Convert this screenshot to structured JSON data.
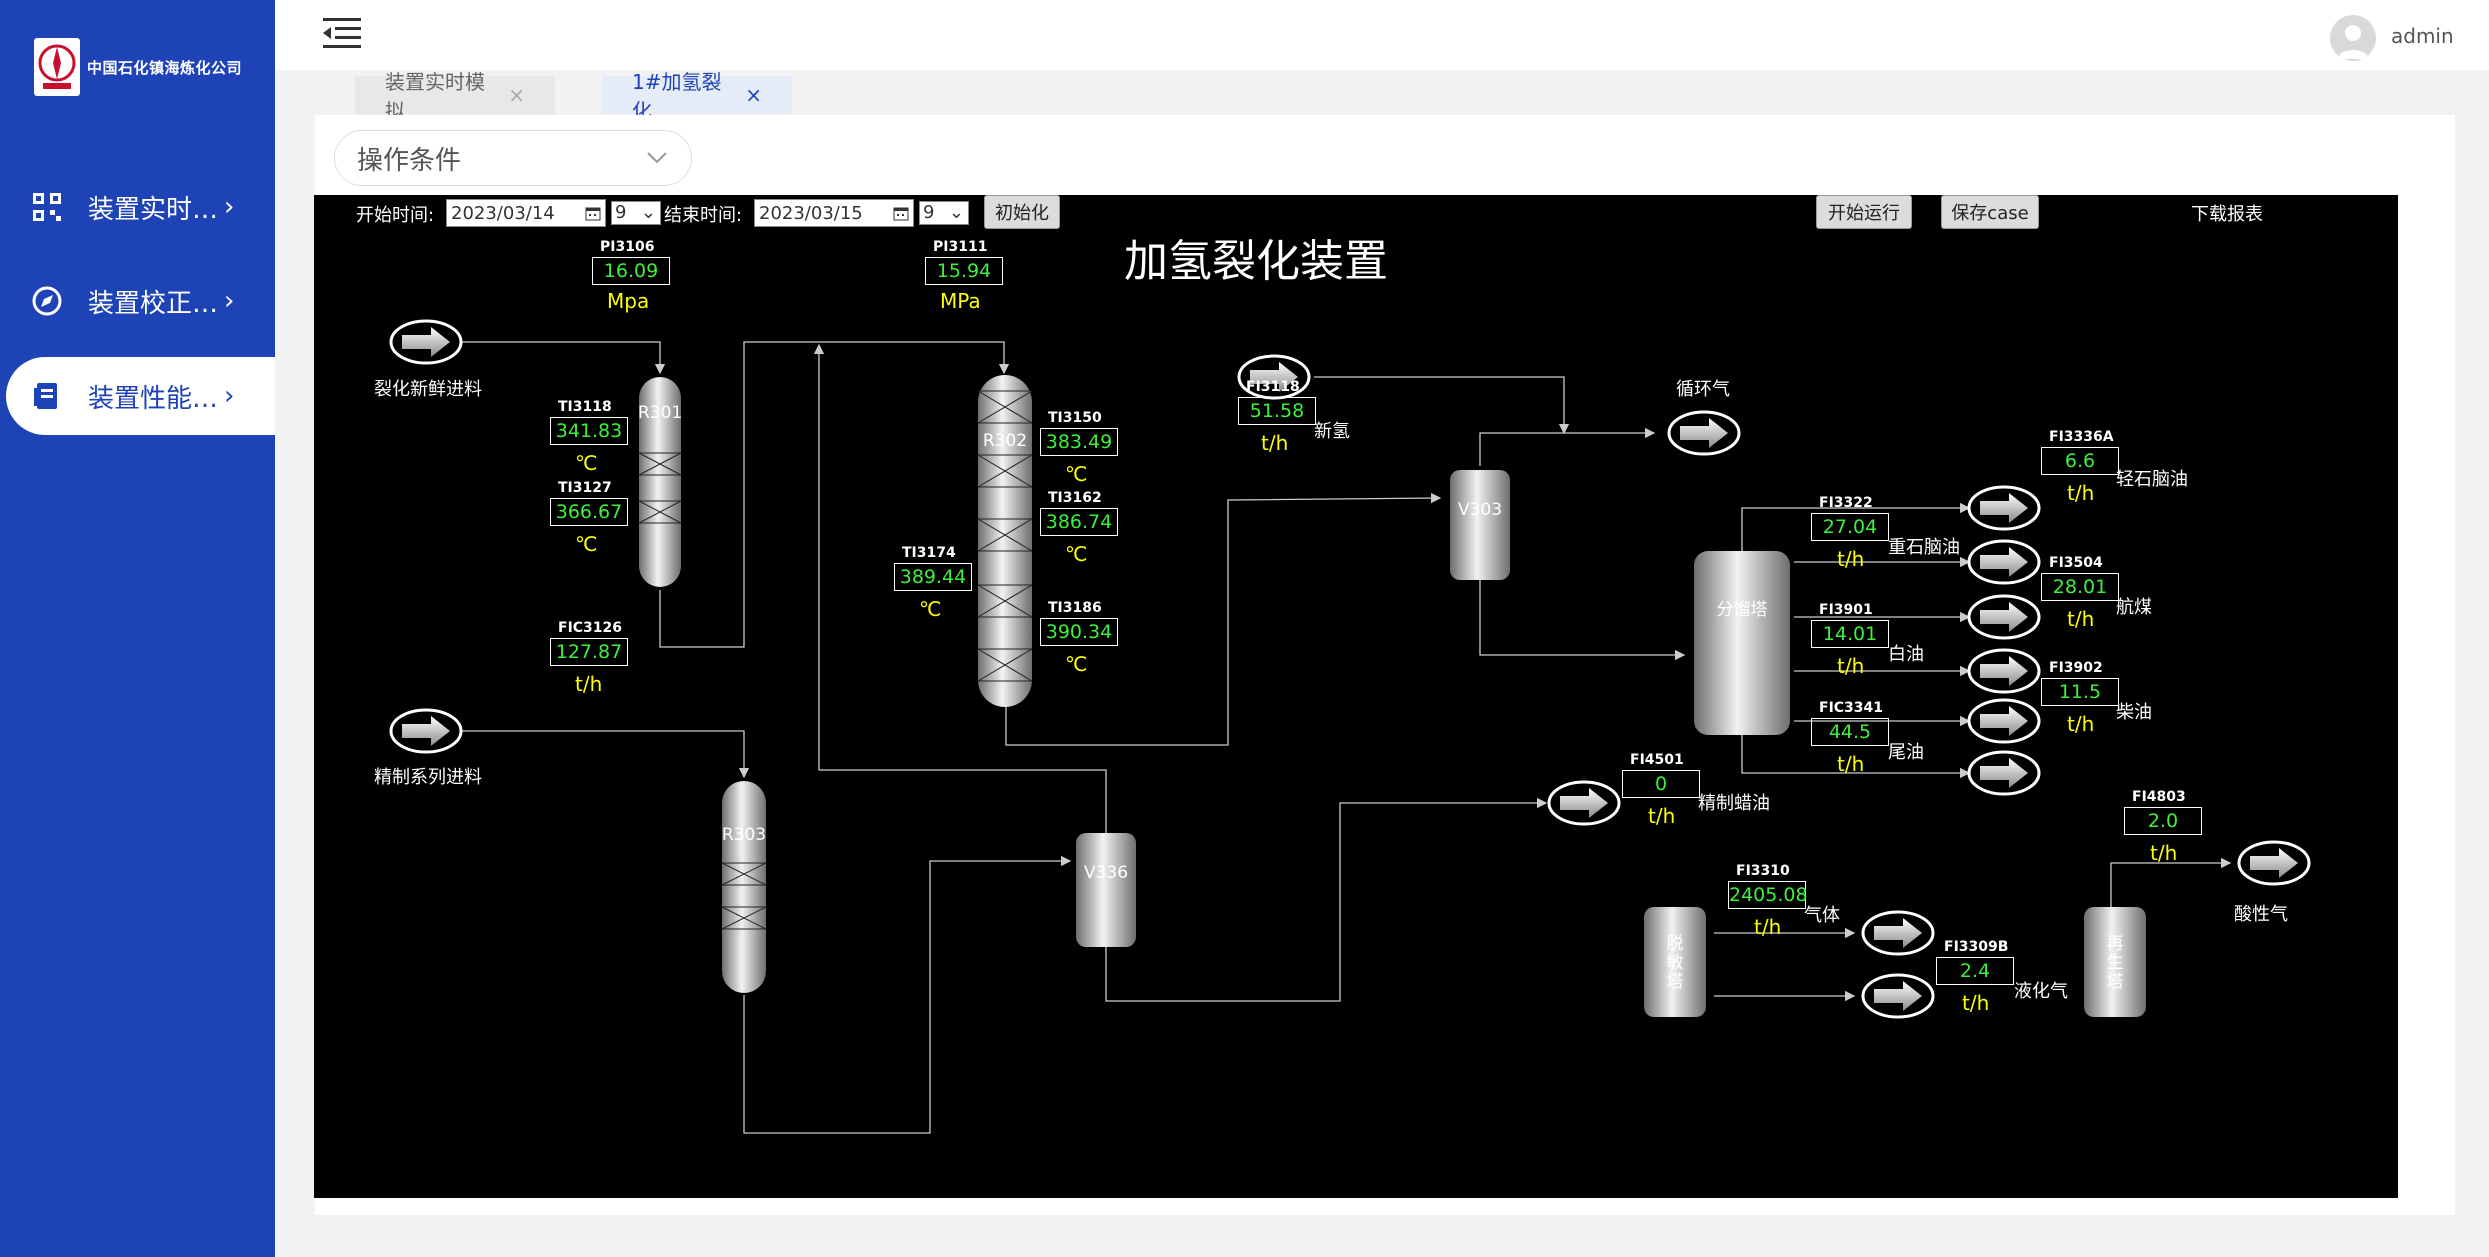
{
  "sidebar": {
    "company": "中国石化镇海炼化公司",
    "logo_text": "SINOPEC",
    "items": [
      {
        "label": "装置实时…",
        "icon": "qrcode-icon"
      },
      {
        "label": "装置校正…",
        "icon": "compass-icon"
      },
      {
        "label": "装置性能…",
        "icon": "document-icon"
      }
    ]
  },
  "header": {
    "username": "admin"
  },
  "tabs": [
    {
      "label": "装置实时模拟",
      "close": "×"
    },
    {
      "label": "1#加氢裂化",
      "close": "×"
    }
  ],
  "condition_select": {
    "value": "操作条件"
  },
  "controls": {
    "start_label": "开始时间:",
    "start_date": "2023/03/14",
    "start_hour": "9",
    "end_label": "结束时间:",
    "end_date": "2023/03/15",
    "end_hour": "9",
    "init": "初始化",
    "run": "开始运行",
    "save": "保存case",
    "download": "下载报表"
  },
  "diagram": {
    "title": "加氢裂化装置",
    "streams": {
      "feed1": "裂化新鲜进料",
      "feed2": "精制系列进料",
      "recycle": "循环气",
      "new_h2": "新氢",
      "light_naphtha": "轻石脑油",
      "heavy_naphtha": "重石脑油",
      "jet": "航煤",
      "white_oil": "白油",
      "diesel": "柴油",
      "tail_oil": "尾油",
      "wax": "精制蜡油",
      "gas": "气体",
      "lpg": "液化气",
      "acid_gas": "酸性气"
    },
    "vessels": {
      "r301": "R301",
      "r302": "R302",
      "r303": "R303",
      "v303": "V303",
      "v336": "V336",
      "fractionator": "分馏塔",
      "desulf": "脱\n敏\n塔",
      "regen": "再\n生\n塔"
    },
    "instruments": {
      "pi3106": {
        "tag": "PI3106",
        "value": "16.09",
        "unit": "Mpa"
      },
      "pi3111": {
        "tag": "PI3111",
        "value": "15.94",
        "unit": "MPa"
      },
      "ti3118": {
        "tag": "TI3118",
        "value": "341.83",
        "unit": "℃"
      },
      "ti3127": {
        "tag": "TI3127",
        "value": "366.67",
        "unit": "℃"
      },
      "fic3126": {
        "tag": "FIC3126",
        "value": "127.87",
        "unit": "t/h"
      },
      "ti3150": {
        "tag": "TI3150",
        "value": "383.49",
        "unit": "℃"
      },
      "ti3162": {
        "tag": "TI3162",
        "value": "386.74",
        "unit": "℃"
      },
      "ti3174": {
        "tag": "TI3174",
        "value": "389.44",
        "unit": "℃"
      },
      "ti3186": {
        "tag": "TI3186",
        "value": "390.34",
        "unit": "℃"
      },
      "fi3118": {
        "tag": "FI3118",
        "value": "51.58",
        "unit": "t/h"
      },
      "fi3336a": {
        "tag": "FI3336A",
        "value": "6.6",
        "unit": "t/h"
      },
      "fi3322": {
        "tag": "FI3322",
        "value": "27.04",
        "unit": "t/h"
      },
      "fi3504": {
        "tag": "FI3504",
        "value": "28.01",
        "unit": "t/h"
      },
      "fi3901": {
        "tag": "FI3901",
        "value": "14.01",
        "unit": "t/h"
      },
      "fi3902": {
        "tag": "FI3902",
        "value": "11.5",
        "unit": "t/h"
      },
      "fic3341": {
        "tag": "FIC3341",
        "value": "44.5",
        "unit": "t/h"
      },
      "fi4501": {
        "tag": "FI4501",
        "value": "0",
        "unit": "t/h"
      },
      "fi3310": {
        "tag": "FI3310",
        "value": "2405.08",
        "unit": "t/h"
      },
      "fi3309b": {
        "tag": "FI3309B",
        "value": "2.4",
        "unit": "t/h"
      },
      "fi4803": {
        "tag": "FI4803",
        "value": "2.0",
        "unit": "t/h"
      }
    }
  }
}
